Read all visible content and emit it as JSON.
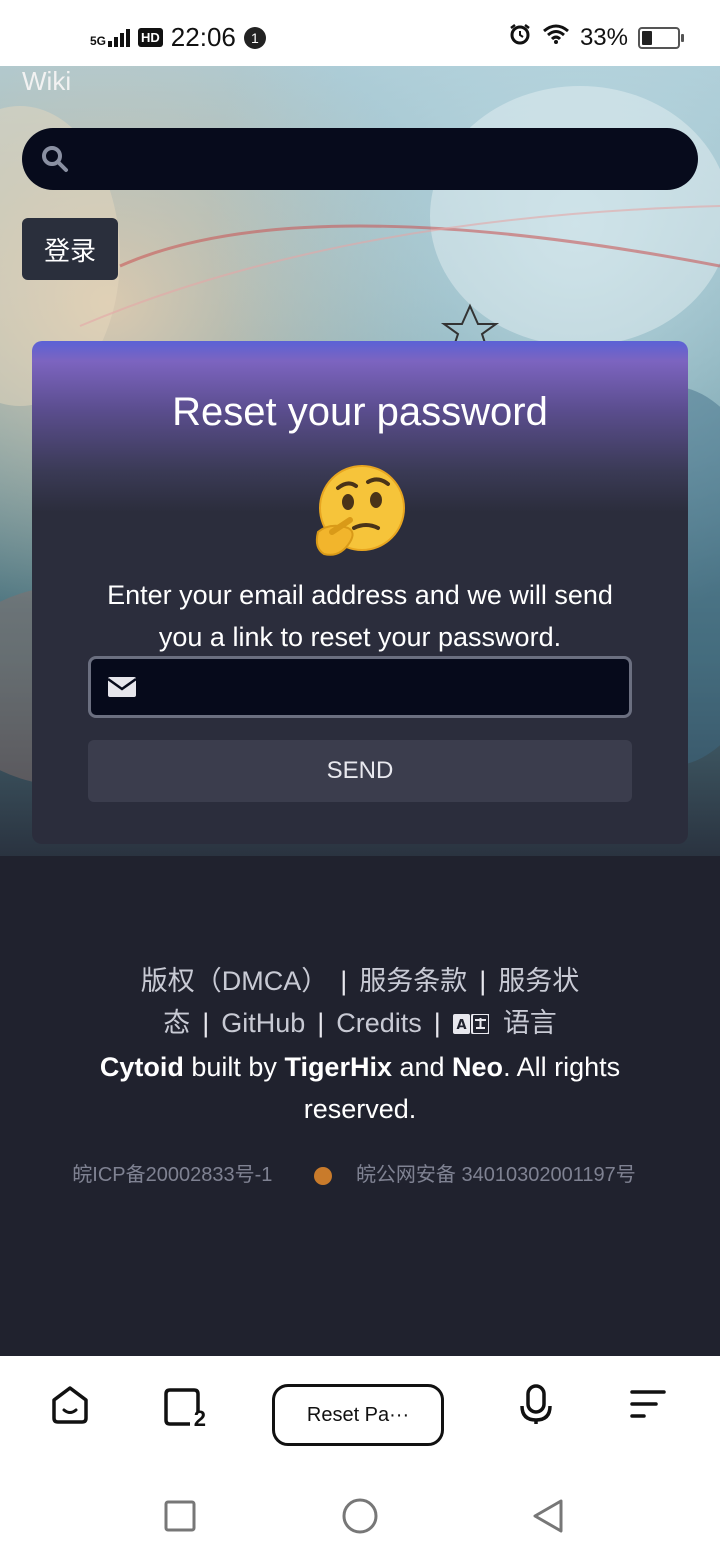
{
  "status_bar": {
    "network": "5G",
    "hd": "HD",
    "time": "22:06",
    "notification_count": "1",
    "battery": "33%",
    "icons": [
      "signal-icon",
      "alarm-icon",
      "wifi-icon",
      "battery-icon"
    ]
  },
  "header": {
    "wiki_label": "Wiki",
    "login_label": "登录"
  },
  "reset_card": {
    "title": "Reset your password",
    "emoji": "thinking-face",
    "description": "Enter your email address and we will send you a link to reset your password.",
    "email_value": "",
    "send_label": "SEND"
  },
  "footer": {
    "links": [
      "版权（DMCA）",
      "服务条款",
      "服务状态",
      "GitHub",
      "Credits",
      "语言"
    ],
    "credit": {
      "cytoid": "Cytoid",
      "built_by": " built by ",
      "tigerhix": "TigerHix",
      "and": " and ",
      "neo": "Neo",
      "rights": ". All rights reserved."
    },
    "icp": "皖ICP备20002833号-1",
    "police": "皖公网安备 34010302001197号"
  },
  "browser_bar": {
    "tab_label": "Reset Pa···",
    "tab_count": "2"
  },
  "colors": {
    "page_bg": "#20222e",
    "card_bg": "#2b2d3c",
    "input_bg": "#060a1b",
    "button_bg": "#3b3d4d",
    "card_gradient_start": "#5b62d6",
    "card_gradient_end": "#7c64c0"
  }
}
